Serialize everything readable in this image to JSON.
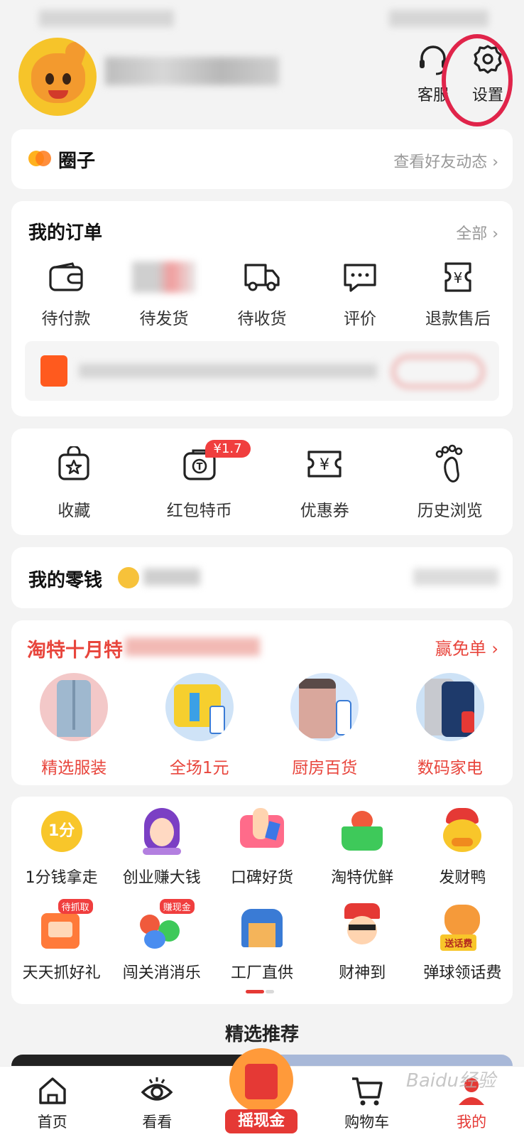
{
  "header": {
    "customer_service_label": "客服",
    "settings_label": "设置"
  },
  "circle": {
    "title": "圈子",
    "link": "查看好友动态 ›"
  },
  "orders": {
    "title": "我的订单",
    "all_link": "全部 ›",
    "items": [
      {
        "label": "待付款",
        "icon": "wallet-icon"
      },
      {
        "label": "待发货",
        "icon": "blurred-image"
      },
      {
        "label": "待收货",
        "icon": "truck-icon"
      },
      {
        "label": "评价",
        "icon": "chat-icon"
      },
      {
        "label": "退款售后",
        "icon": "refund-icon"
      }
    ]
  },
  "tools": {
    "items": [
      {
        "label": "收藏",
        "icon": "star-bag-icon"
      },
      {
        "label": "红包特币",
        "icon": "coin-bag-icon",
        "badge": "¥1.7"
      },
      {
        "label": "优惠券",
        "icon": "coupon-icon"
      },
      {
        "label": "历史浏览",
        "icon": "footprint-icon"
      }
    ]
  },
  "wallet": {
    "title": "我的零钱"
  },
  "promo": {
    "title": "淘特十月特",
    "link": "赢免单 ›",
    "items": [
      {
        "label": "精选服装",
        "icon": "jacket-image"
      },
      {
        "label": "全场1元",
        "icon": "tshirt-image"
      },
      {
        "label": "厨房百货",
        "icon": "trashcan-image"
      },
      {
        "label": "数码家电",
        "icon": "phone-image"
      }
    ]
  },
  "grid": {
    "row1": [
      {
        "label": "1分钱拿走",
        "icon": "one-cent-icon",
        "icon_text": "1分"
      },
      {
        "label": "创业赚大钱",
        "icon": "girl-avatar-icon"
      },
      {
        "label": "口碑好货",
        "icon": "thumbs-up-icon"
      },
      {
        "label": "淘特优鲜",
        "icon": "fruit-basket-icon"
      },
      {
        "label": "发财鸭",
        "icon": "duck-icon"
      }
    ],
    "row2": [
      {
        "label": "天天抓好礼",
        "icon": "claw-machine-icon",
        "badge": "待抓取"
      },
      {
        "label": "闯关消消乐",
        "icon": "fruit-game-icon",
        "badge": "赚现金"
      },
      {
        "label": "工厂直供",
        "icon": "warehouse-icon"
      },
      {
        "label": "财神到",
        "icon": "fortune-god-icon"
      },
      {
        "label": "弹球领话费",
        "icon": "fox-icon",
        "badge": "送话费"
      }
    ]
  },
  "recommend": {
    "title": "精选推荐"
  },
  "tabbar": {
    "items": [
      {
        "label": "首页",
        "icon": "home-icon"
      },
      {
        "label": "看看",
        "icon": "eye-icon"
      },
      {
        "label": "摇现金",
        "icon": "red-envelope-icon"
      },
      {
        "label": "购物车",
        "icon": "cart-icon"
      },
      {
        "label": "我的",
        "icon": "profile-icon"
      }
    ]
  },
  "watermark": "Baidu经验",
  "colors": {
    "accent_red": "#e53935",
    "promo_red": "#e8453c",
    "background": "#f3f3f3",
    "highlight_circle": "#e0244a"
  }
}
